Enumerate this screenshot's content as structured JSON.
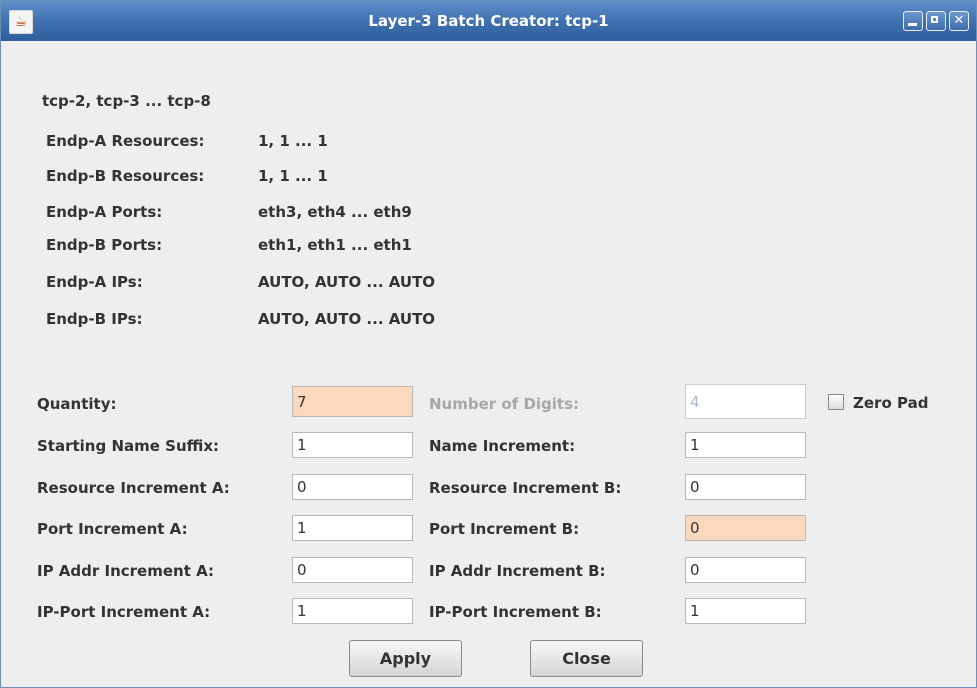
{
  "window": {
    "title": "Layer-3 Batch Creator: tcp-1"
  },
  "summary": {
    "names": "tcp-2, tcp-3 ... tcp-8",
    "rows": [
      {
        "label": "Endp-A Resources:",
        "value": "1, 1 ... 1"
      },
      {
        "label": "Endp-B Resources:",
        "value": "1, 1 ... 1"
      },
      {
        "label": "Endp-A Ports:",
        "value": "eth3, eth4 ... eth9"
      },
      {
        "label": "Endp-B Ports:",
        "value": "eth1, eth1 ... eth1"
      },
      {
        "label": "Endp-A IPs:",
        "value": "AUTO, AUTO ... AUTO"
      },
      {
        "label": "Endp-B IPs:",
        "value": "AUTO, AUTO ... AUTO"
      }
    ]
  },
  "form": {
    "quantity": {
      "label": "Quantity:",
      "value": "7"
    },
    "number_of_digits": {
      "label": "Number of Digits:",
      "value": "4"
    },
    "zero_pad": {
      "label": "Zero Pad",
      "checked": false
    },
    "starting_name_suffix": {
      "label": "Starting Name Suffix:",
      "value": "1"
    },
    "name_increment": {
      "label": "Name Increment:",
      "value": "1"
    },
    "resource_increment_a": {
      "label": "Resource Increment A:",
      "value": "0"
    },
    "resource_increment_b": {
      "label": "Resource Increment B:",
      "value": "0"
    },
    "port_increment_a": {
      "label": "Port Increment A:",
      "value": "1"
    },
    "port_increment_b": {
      "label": "Port Increment B:",
      "value": "0"
    },
    "ip_addr_increment_a": {
      "label": "IP Addr Increment A:",
      "value": "0"
    },
    "ip_addr_increment_b": {
      "label": "IP Addr Increment B:",
      "value": "0"
    },
    "ip_port_increment_a": {
      "label": "IP-Port Increment A:",
      "value": "1"
    },
    "ip_port_increment_b": {
      "label": "IP-Port Increment B:",
      "value": "1"
    }
  },
  "buttons": {
    "apply": "Apply",
    "close": "Close"
  },
  "colors": {
    "titlebar": "#3e6fae",
    "highlight_field": "#fcd9bd"
  },
  "icons": {
    "app": "java-cup-icon",
    "minimize": "minimize-icon",
    "maximize": "maximize-icon",
    "close": "close-icon"
  }
}
